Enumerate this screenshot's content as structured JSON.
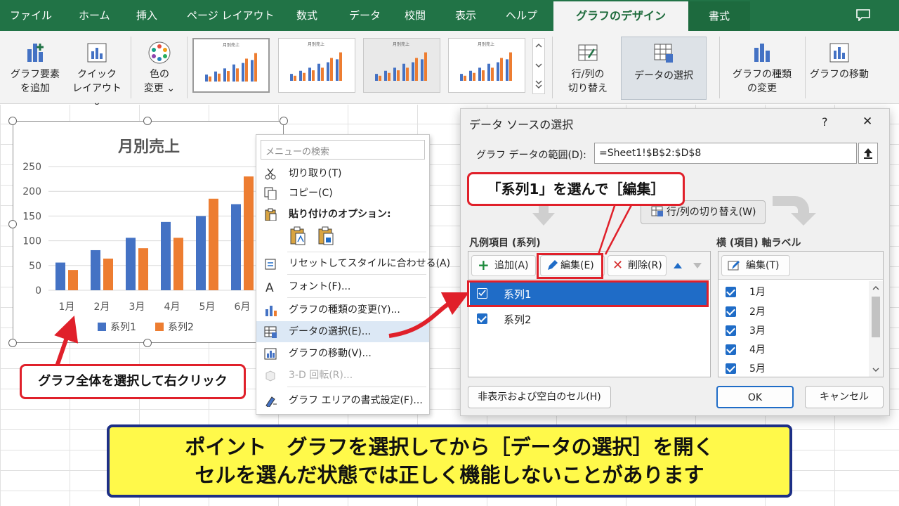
{
  "ribbon_tabs": [
    "ファイル",
    "ホーム",
    "挿入",
    "ページ レイアウト",
    "数式",
    "データ",
    "校閲",
    "表示",
    "ヘルプ"
  ],
  "active_tab": "グラフのデザイン",
  "format_tab": "書式",
  "ribbon": {
    "add_element": [
      "グラフ要素",
      "を追加"
    ],
    "quick_layout": [
      "クイック",
      "レイアウト"
    ],
    "change_color": [
      "色の",
      "変更"
    ],
    "switch_row_col": [
      "行/列の",
      "切り替え"
    ],
    "select_data": "データの選択",
    "change_type": [
      "グラフの種類",
      "の変更"
    ],
    "move_chart": "グラフの移動",
    "thumb_title": "月別売上"
  },
  "chart_data": {
    "type": "bar",
    "title": "月別売上",
    "categories": [
      "1月",
      "2月",
      "3月",
      "4月",
      "5月",
      "6月"
    ],
    "series": [
      {
        "name": "系列1",
        "color": "#4472c4",
        "values": [
          56,
          81,
          106,
          138,
          150,
          174
        ]
      },
      {
        "name": "系列2",
        "color": "#ed7d31",
        "values": [
          41,
          64,
          85,
          106,
          185,
          230
        ]
      }
    ],
    "ylim": [
      0,
      250
    ],
    "yticks": [
      "0",
      "50",
      "100",
      "150",
      "200",
      "250"
    ],
    "grid": true,
    "legend": "bottom"
  },
  "context_menu": {
    "search_placeholder": "メニューの検索",
    "items": [
      {
        "label": "切り取り(T)",
        "icon": "scissors-icon"
      },
      {
        "label": "コピー(C)",
        "icon": "copy-icon"
      },
      {
        "label": "貼り付けのオプション:",
        "icon": "paste-icon"
      },
      {
        "label": "リセットしてスタイルに合わせる(A)",
        "icon": "reset-style-icon"
      },
      {
        "label": "フォント(F)...",
        "icon": "font-icon"
      },
      {
        "label": "グラフの種類の変更(Y)...",
        "icon": "chart-type-icon"
      },
      {
        "label": "データの選択(E)...",
        "icon": "select-data-icon"
      },
      {
        "label": "グラフの移動(V)...",
        "icon": "move-chart-icon"
      },
      {
        "label": "3-D 回転(R)...",
        "icon": "rotate-3d-icon"
      },
      {
        "label": "グラフ エリアの書式設定(F)...",
        "icon": "format-area-icon"
      }
    ]
  },
  "dialog": {
    "title": "データ ソースの選択",
    "help": "?",
    "close": "✕",
    "range_label": "グラフ データの範囲(D):",
    "range_value": "=Sheet1!$B$2:$D$8",
    "switch_button": "行/列の切り替え(W)",
    "legend_header": "凡例項目 (系列)",
    "add": "追加(A)",
    "edit": "編集(E)",
    "delete": "削除(R)",
    "series": [
      "系列1",
      "系列2"
    ],
    "axis_header": "横 (項目) 軸ラベル",
    "axis_edit": "編集(T)",
    "axis_items": [
      "1月",
      "2月",
      "3月",
      "4月",
      "5月"
    ],
    "hidden_cells": "非表示および空白のセル(H)",
    "ok": "OK",
    "cancel": "キャンセル"
  },
  "callouts": {
    "select_series": "「系列1」を選んで［編集］",
    "select_chart": "グラフ全体を選択して右クリック"
  },
  "banner": {
    "line1": "ポイント　グラフを選択してから［データの選択］を開く",
    "line2": "セルを選んだ状態では正しく機能しないことがあります"
  },
  "colors": {
    "excel_green": "#217346",
    "accent_red": "#e0202a",
    "banner_yellow": "#fff94a",
    "banner_border": "#1d2f86",
    "selection_blue": "#1f6cc7"
  }
}
